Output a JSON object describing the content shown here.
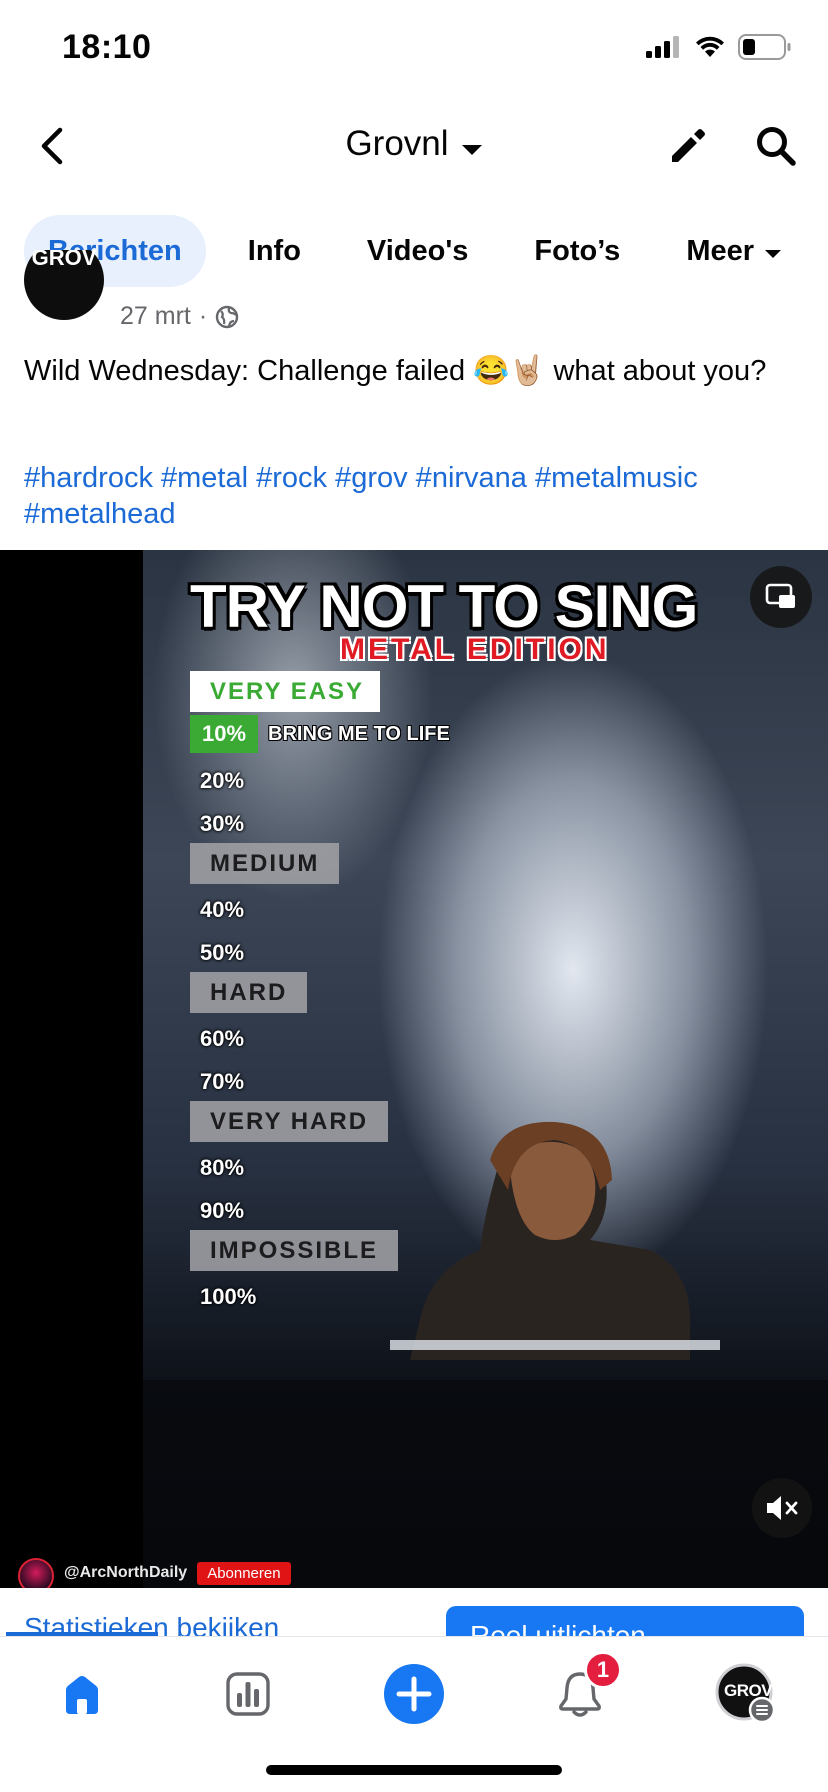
{
  "status_bar": {
    "time": "18:10"
  },
  "header": {
    "title": "Grovnl"
  },
  "tabs": [
    {
      "label": "Berichten",
      "active": true
    },
    {
      "label": "Info"
    },
    {
      "label": "Video's"
    },
    {
      "label": "Foto’s"
    },
    {
      "label": "Meer"
    }
  ],
  "post": {
    "avatar_text": "GROV",
    "date": "27 mrt",
    "dot": "·",
    "text": "Wild Wednesday: Challenge failed 😂🤘🏼 what about you?",
    "hashtags": "#hardrock #metal #rock #grov #nirvana #metalmusic #metalhead"
  },
  "video": {
    "title": "TRY NOT TO SING",
    "subtitle": "METAL EDITION",
    "levels": {
      "very_easy": "VERY EASY",
      "medium": "MEDIUM",
      "hard": "HARD",
      "very_hard": "VERY HARD",
      "impossible": "IMPOSSIBLE"
    },
    "percentages": [
      "10%",
      "20%",
      "30%",
      "40%",
      "50%",
      "60%",
      "70%",
      "80%",
      "90%",
      "100%"
    ],
    "current_song": "BRING ME TO LIFE",
    "credit_handle": "@ArcNorthDaily",
    "credit_subscribe": "Abonneren"
  },
  "actions": {
    "stats_label": "Statistieken bekijken",
    "promote_label": "Reel uitlichten"
  },
  "bottom_nav": {
    "notifications_badge": "1",
    "profile_avatar_text": "GROV"
  },
  "colors": {
    "accent": "#1b6ad6",
    "active_tab_bg": "#e7f0fc",
    "badge": "#e41e3f",
    "level_green": "#3aaa35",
    "metal_red": "#e01b24"
  }
}
